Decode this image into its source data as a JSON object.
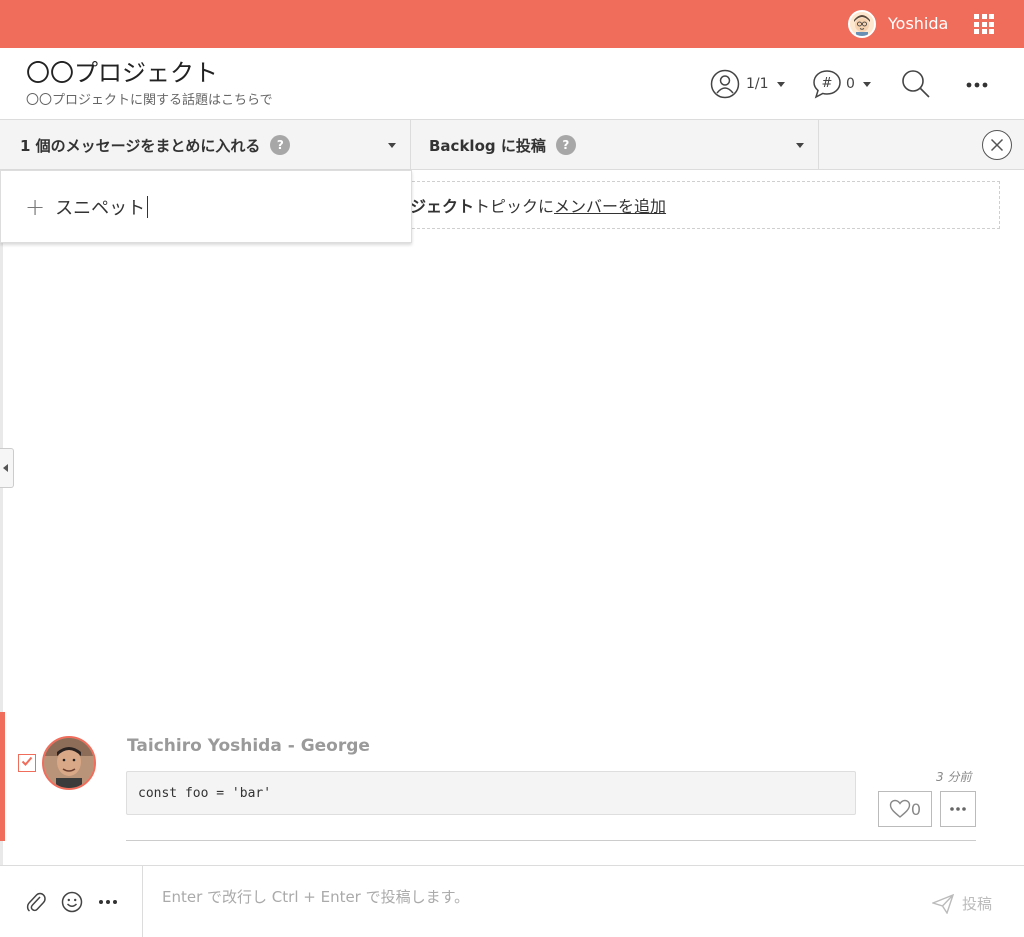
{
  "topbar": {
    "username": "Yoshida",
    "bg_color": "#f06d5c"
  },
  "header": {
    "title": "〇〇プロジェクト",
    "subtitle": "〇〇プロジェクトに関する話題はこちらで",
    "members_count": "1/1",
    "topics_count": "0"
  },
  "dropbar": {
    "merge_label": "1 個のメッセージをまとめに入れる",
    "backlog_label": "Backlog に投稿",
    "help": "?"
  },
  "info": {
    "bold_text": "ジェクト",
    "mid_text": "トピックに",
    "link_text": "メンバーを追加"
  },
  "popup": {
    "plus": "+",
    "text": "スニペット"
  },
  "message": {
    "author": "Taichiro Yoshida - George",
    "code": "const foo = 'bar'",
    "time": "3 分前",
    "likes": "0"
  },
  "composer": {
    "placeholder": "Enter で改行し Ctrl + Enter で投稿します。",
    "post_label": "投稿"
  }
}
